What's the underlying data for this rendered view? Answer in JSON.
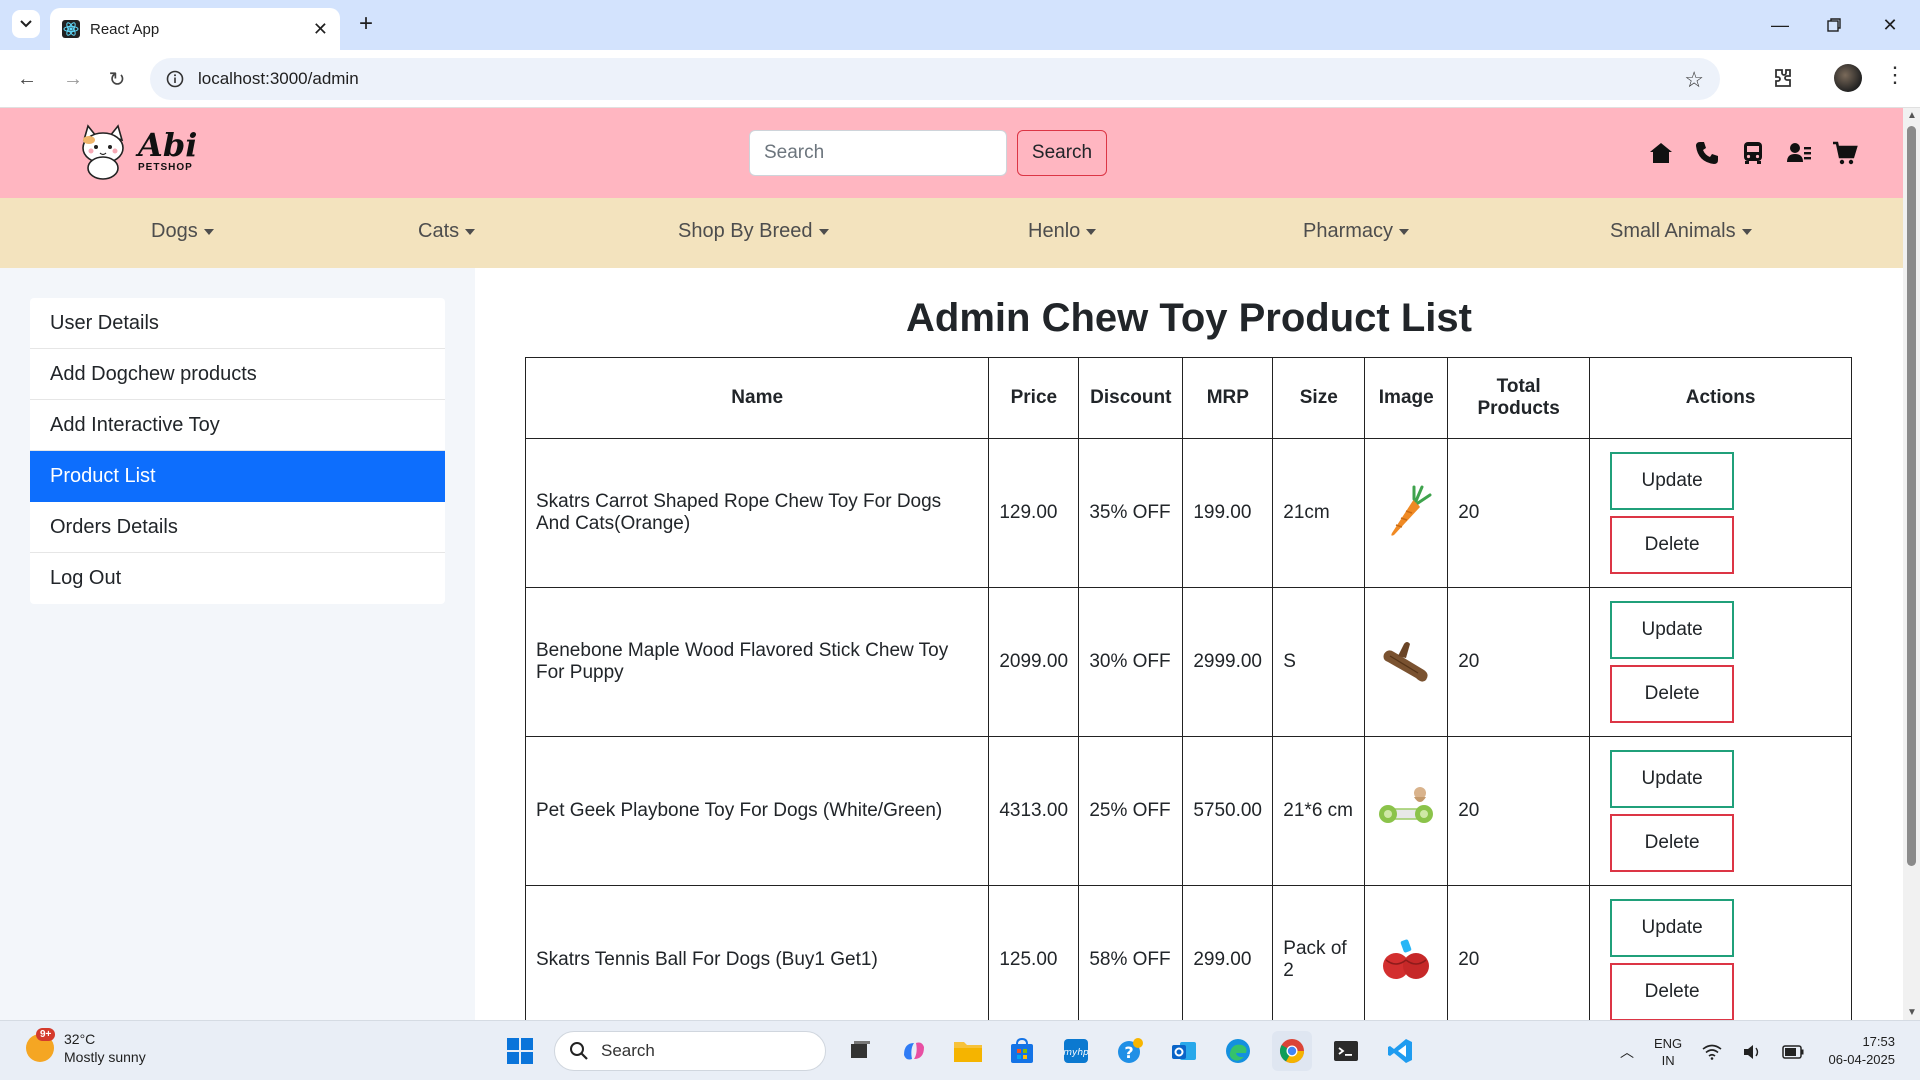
{
  "browser": {
    "tab_title": "React App",
    "url": "localhost:3000/admin"
  },
  "header": {
    "logo_title": "Abi",
    "logo_subtitle": "PETSHOP",
    "search_placeholder": "Search",
    "search_button": "Search"
  },
  "categories": [
    {
      "label": "Dogs"
    },
    {
      "label": "Cats"
    },
    {
      "label": "Shop By Breed"
    },
    {
      "label": "Henlo"
    },
    {
      "label": "Pharmacy"
    },
    {
      "label": "Small Animals"
    }
  ],
  "sidebar": {
    "items": [
      {
        "label": "User Details"
      },
      {
        "label": "Add Dogchew products"
      },
      {
        "label": "Add Interactive Toy"
      },
      {
        "label": "Product List",
        "active": true
      },
      {
        "label": "Orders Details"
      },
      {
        "label": "Log Out"
      }
    ]
  },
  "main": {
    "title": "Admin Chew Toy Product List",
    "columns": [
      "Name",
      "Price",
      "Discount",
      "MRP",
      "Size",
      "Image",
      "Total Products",
      "Actions"
    ],
    "update_label": "Update",
    "delete_label": "Delete",
    "rows": [
      {
        "name": "Skatrs Carrot Shaped Rope Chew Toy For Dogs And Cats(Orange)",
        "price": "129.00",
        "discount": "35% OFF",
        "mrp": "199.00",
        "size": "21cm",
        "image_icon": "carrot-toy-icon",
        "total": "20"
      },
      {
        "name": "Benebone Maple Wood Flavored Stick Chew Toy For Puppy",
        "price": "2099.00",
        "discount": "30% OFF",
        "mrp": "2999.00",
        "size": "S",
        "image_icon": "wood-stick-toy-icon",
        "total": "20"
      },
      {
        "name": "Pet Geek Playbone Toy For Dogs (White/Green)",
        "price": "4313.00",
        "discount": "25% OFF",
        "mrp": "5750.00",
        "size": "21*6 cm",
        "image_icon": "playbone-toy-icon",
        "total": "20"
      },
      {
        "name": "Skatrs Tennis Ball For Dogs (Buy1 Get1)",
        "price": "125.00",
        "discount": "58% OFF",
        "mrp": "299.00",
        "size": "Pack of 2",
        "image_icon": "tennis-ball-toy-icon",
        "total": "20"
      }
    ]
  },
  "taskbar": {
    "temperature": "32°C",
    "weather": "Mostly sunny",
    "weather_badge": "9+",
    "search_label": "Search",
    "lang_top": "ENG",
    "lang_bottom": "IN",
    "time": "17:53",
    "date": "06-04-2025"
  },
  "colors": {
    "header_bg": "#ffb6c1",
    "nav_bg": "#f3e3be",
    "active_item": "#0d6efd",
    "update_border": "#20a07a",
    "delete_border": "#dc3545"
  }
}
